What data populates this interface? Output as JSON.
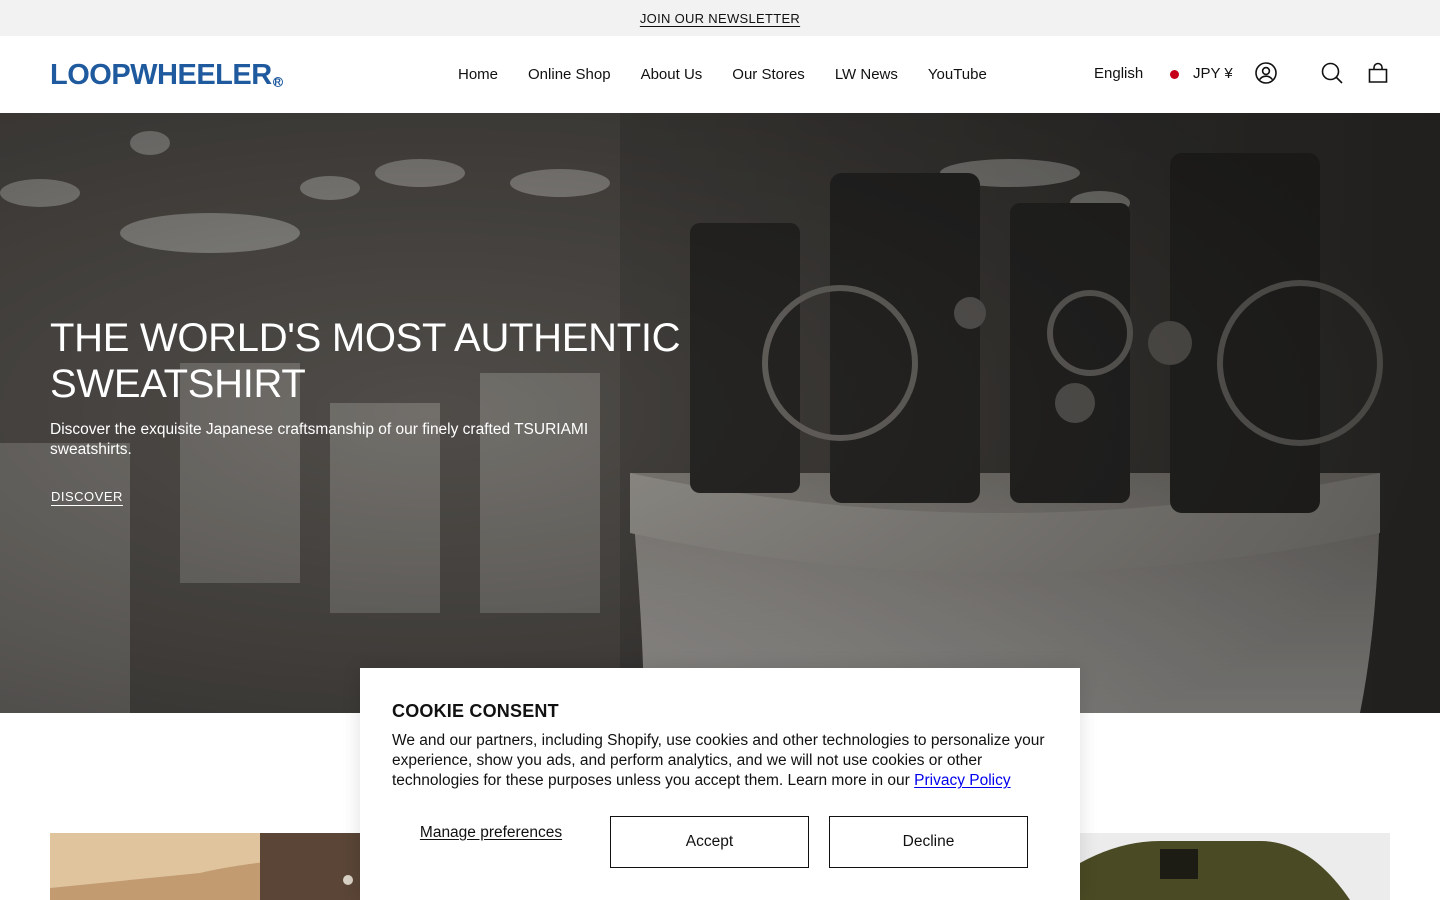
{
  "announcement": {
    "text": "JOIN OUR NEWSLETTER"
  },
  "header": {
    "logo_text": "LOOPWHEELER",
    "logo_mark": "R",
    "nav": [
      "Home",
      "Online Shop",
      "About Us",
      "Our Stores",
      "LW News",
      "YouTube"
    ],
    "language": "English",
    "currency": "JPY ¥",
    "icons": [
      "japan-flag-icon",
      "account-icon",
      "search-icon",
      "cart-icon"
    ]
  },
  "hero": {
    "title": "THE WORLD'S MOST AUTHENTIC SWEATSHIRT",
    "subtitle": "Discover the exquisite Japanese craftsmanship of our finely crafted TSURIAMI sweatshirts.",
    "cta": "DISCOVER"
  },
  "cookie": {
    "title": "COOKIE CONSENT",
    "body": "We and our partners, including Shopify, use cookies and other technologies to personalize your experience, show you ads, and perform analytics, and we will not use cookies or other technologies for these purposes unless you accept them. Learn more in our",
    "policy_link": "Privacy Policy",
    "manage": "Manage preferences",
    "accept": "Accept",
    "decline": "Decline"
  },
  "colors": {
    "brand_blue": "#1f5a9e",
    "flag_red": "#c4001a",
    "announce_bg": "#f2f2f2"
  }
}
